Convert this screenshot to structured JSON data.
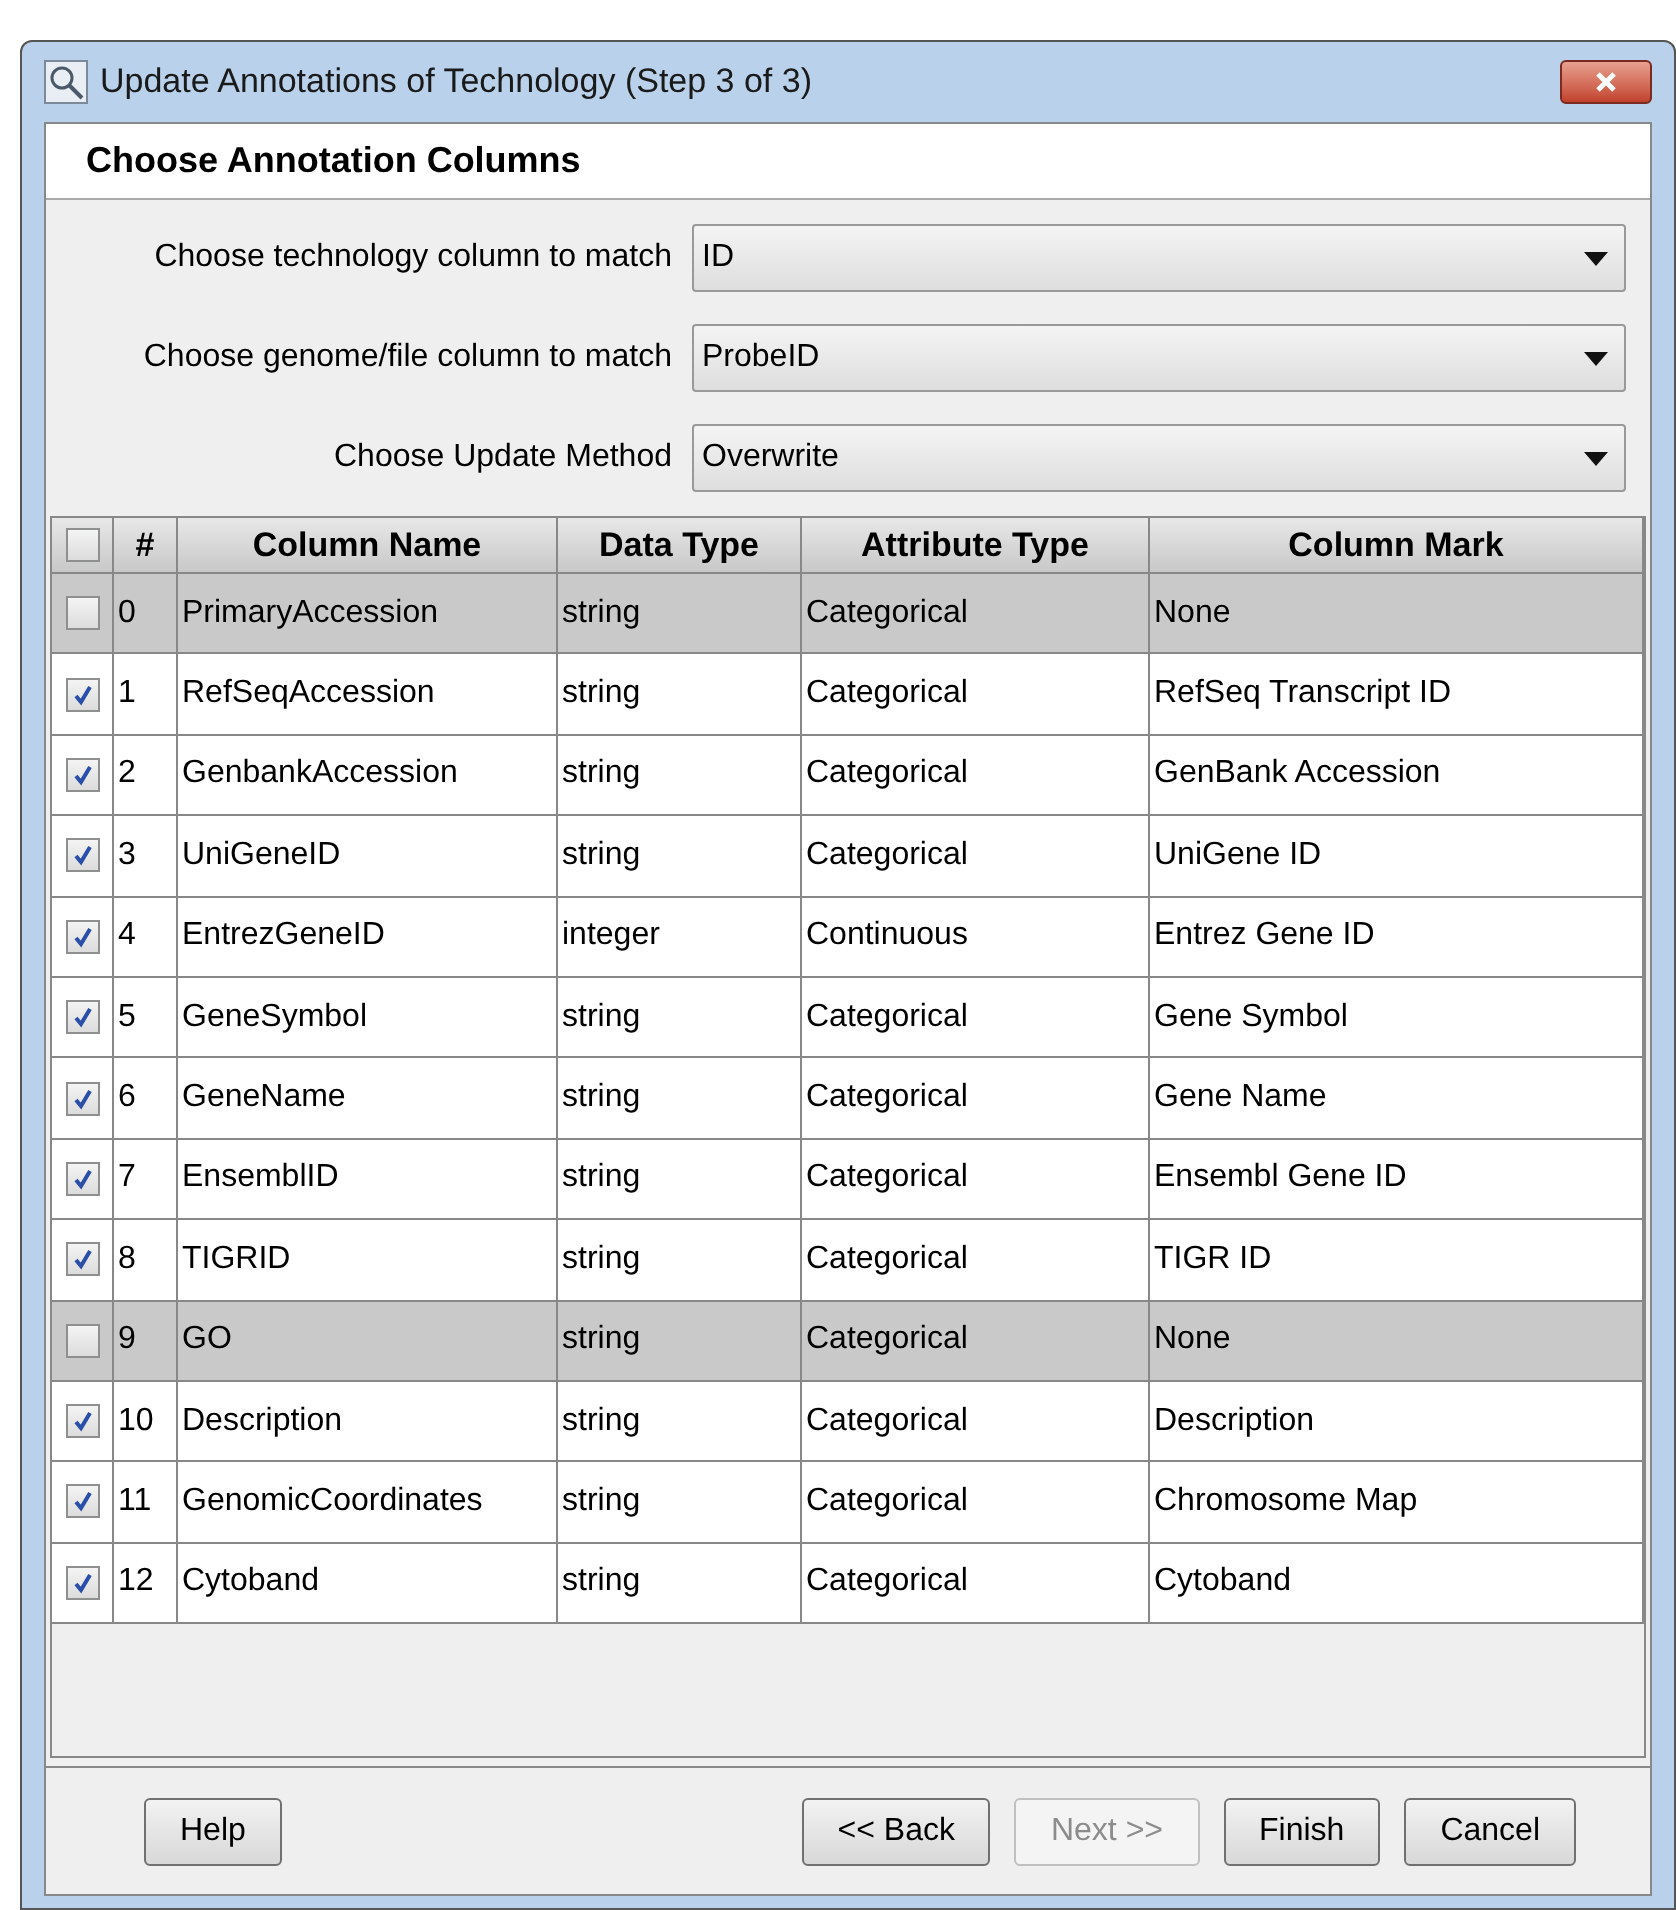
{
  "window": {
    "title": "Update Annotations of Technology (Step 3 of 3)"
  },
  "header": "Choose Annotation Columns",
  "form": [
    {
      "label": "Choose technology column to match",
      "value": "ID"
    },
    {
      "label": "Choose genome/file column to match",
      "value": "ProbeID"
    },
    {
      "label": "Choose Update Method",
      "value": "Overwrite"
    }
  ],
  "table": {
    "select_all": {
      "checked": false
    },
    "columns": [
      "#",
      "Column Name",
      "Data Type",
      "Attribute Type",
      "Column Mark"
    ],
    "rows": [
      {
        "checked": false,
        "cells": [
          "0",
          "PrimaryAccession",
          "string",
          "Categorical",
          "None"
        ]
      },
      {
        "checked": true,
        "cells": [
          "1",
          "RefSeqAccession",
          "string",
          "Categorical",
          "RefSeq Transcript ID"
        ]
      },
      {
        "checked": true,
        "cells": [
          "2",
          "GenbankAccession",
          "string",
          "Categorical",
          "GenBank Accession"
        ]
      },
      {
        "checked": true,
        "cells": [
          "3",
          "UniGeneID",
          "string",
          "Categorical",
          "UniGene ID"
        ]
      },
      {
        "checked": true,
        "cells": [
          "4",
          "EntrezGeneID",
          "integer",
          "Continuous",
          "Entrez Gene ID"
        ]
      },
      {
        "checked": true,
        "cells": [
          "5",
          "GeneSymbol",
          "string",
          "Categorical",
          "Gene Symbol"
        ]
      },
      {
        "checked": true,
        "cells": [
          "6",
          "GeneName",
          "string",
          "Categorical",
          "Gene Name"
        ]
      },
      {
        "checked": true,
        "cells": [
          "7",
          "EnsemblID",
          "string",
          "Categorical",
          "Ensembl Gene ID"
        ]
      },
      {
        "checked": true,
        "cells": [
          "8",
          "TIGRID",
          "string",
          "Categorical",
          "TIGR ID"
        ]
      },
      {
        "checked": false,
        "cells": [
          "9",
          "GO",
          "string",
          "Categorical",
          "None"
        ]
      },
      {
        "checked": true,
        "cells": [
          "10",
          "Description",
          "string",
          "Categorical",
          "Description"
        ]
      },
      {
        "checked": true,
        "cells": [
          "11",
          "GenomicCoordinates",
          "string",
          "Categorical",
          "Chromosome Map"
        ]
      },
      {
        "checked": true,
        "cells": [
          "12",
          "Cytoband",
          "string",
          "Categorical",
          "Cytoband"
        ]
      }
    ]
  },
  "buttons": [
    {
      "label": "Help",
      "disabled": false
    },
    {
      "label": "<< Back",
      "disabled": false
    },
    {
      "label": "Next >>",
      "disabled": true
    },
    {
      "label": "Finish",
      "disabled": false
    },
    {
      "label": "Cancel",
      "disabled": false
    }
  ]
}
